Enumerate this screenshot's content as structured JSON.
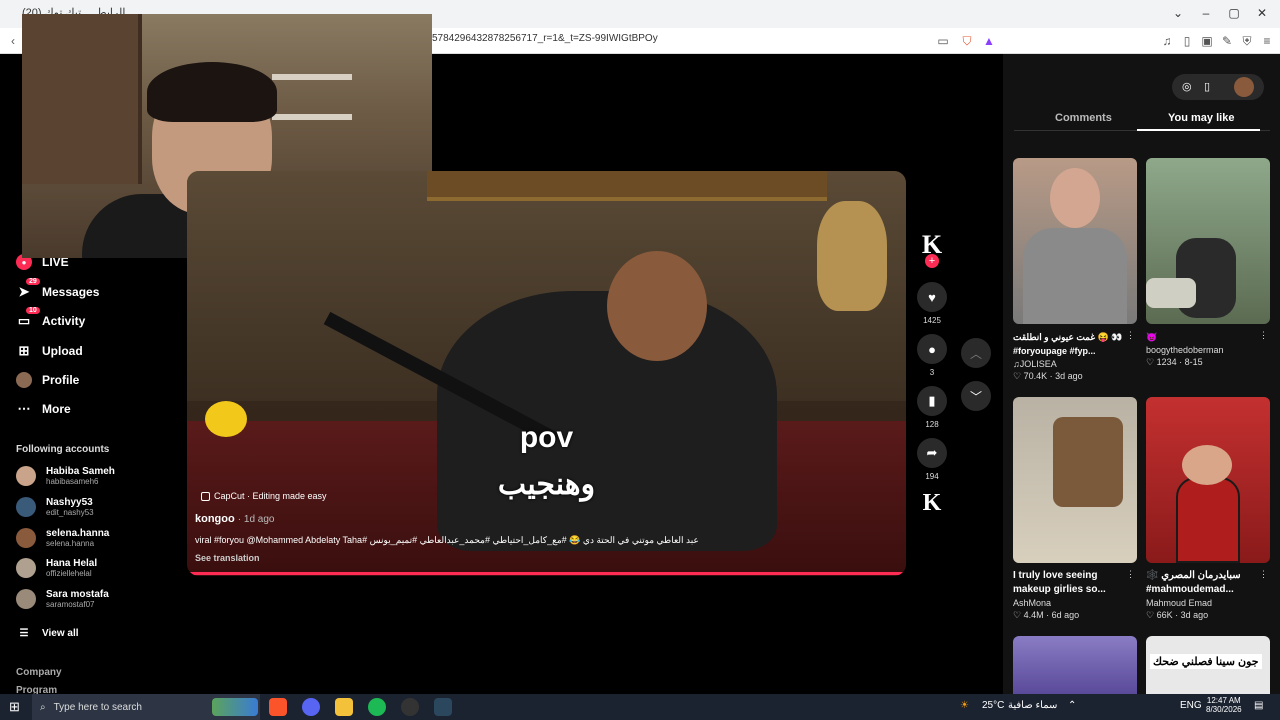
{
  "browser": {
    "tab_title": "(20) الرابط ... تيك توك",
    "url": "5784296432878256717_r=1&_t=ZS-99IWIGtBPOy"
  },
  "sidebar": {
    "items": [
      {
        "label": "LIVE",
        "icon": "live-icon"
      },
      {
        "label": "Messages",
        "icon": "messages-icon",
        "badge": "29"
      },
      {
        "label": "Activity",
        "icon": "activity-icon",
        "badge": "10"
      },
      {
        "label": "Upload",
        "icon": "upload-icon"
      },
      {
        "label": "Profile",
        "icon": "profile-icon"
      },
      {
        "label": "More",
        "icon": "more-icon"
      }
    ],
    "following_title": "Following accounts",
    "accounts": [
      {
        "name": "Habiba Sameh",
        "handle": "habibasameh6"
      },
      {
        "name": "Nashyy53",
        "handle": "edit_nashy53"
      },
      {
        "name": "selena.hanna",
        "handle": "selena.hanna"
      },
      {
        "name": "Hana Helal",
        "handle": "offiziellehelal"
      },
      {
        "name": "Sara mostafa",
        "handle": "saramostaf07"
      }
    ],
    "view_all": "View all",
    "footer": [
      "Company",
      "Program"
    ]
  },
  "video": {
    "caption_top": "pov",
    "caption_bottom": "وهنجيب",
    "capcut": "CapCut · Editing made easy",
    "author": "kongoo",
    "time": "· 1d ago",
    "description": "عبد العاطي موتني في الحتة دي 😂 #مع_كامل_احتياطي #محمد_عبدالعاطي #تميم_يونس #viral #foryou @Mohammed Abdelaty Taha",
    "see_translation": "See translation"
  },
  "actions": {
    "like_count": "1425",
    "comment_count": "3",
    "save_count": "128",
    "share_count": "194"
  },
  "panel": {
    "tab_comments": "Comments",
    "tab_you_may_like": "You may like",
    "cards": [
      {
        "title": "👀 😝 غمت عيوني و انطلقت",
        "title2": "#foryoupage #fyp...",
        "author": "♫JOLISEA",
        "likes": "♡ 70.4K",
        "date": "3d ago"
      },
      {
        "title": "😈",
        "title2": "",
        "author": "boogythedoberman",
        "likes": "♡ 1234",
        "date": "8-15"
      },
      {
        "title": "I truly love seeing",
        "title2": "makeup girlies so...",
        "author": "AshMona",
        "likes": "♡ 4.4M",
        "date": "6d ago"
      },
      {
        "title": "سبايدرمان المصري 🕸️",
        "title2": "#mahmoudemad...",
        "author": "Mahmoud Emad",
        "likes": "♡ 66K",
        "date": "3d ago"
      }
    ],
    "thumb_overlay_text": "جون سينا فصلني ضحك"
  },
  "taskbar": {
    "search_placeholder": "Type here to search",
    "temp": "25°C",
    "weather": "سماء صافية",
    "lang": "ENG",
    "time": "12:47 AM",
    "date": "8/30/2026"
  },
  "colors": {
    "accent": "#fe2c55",
    "panel_bg": "#121212"
  }
}
